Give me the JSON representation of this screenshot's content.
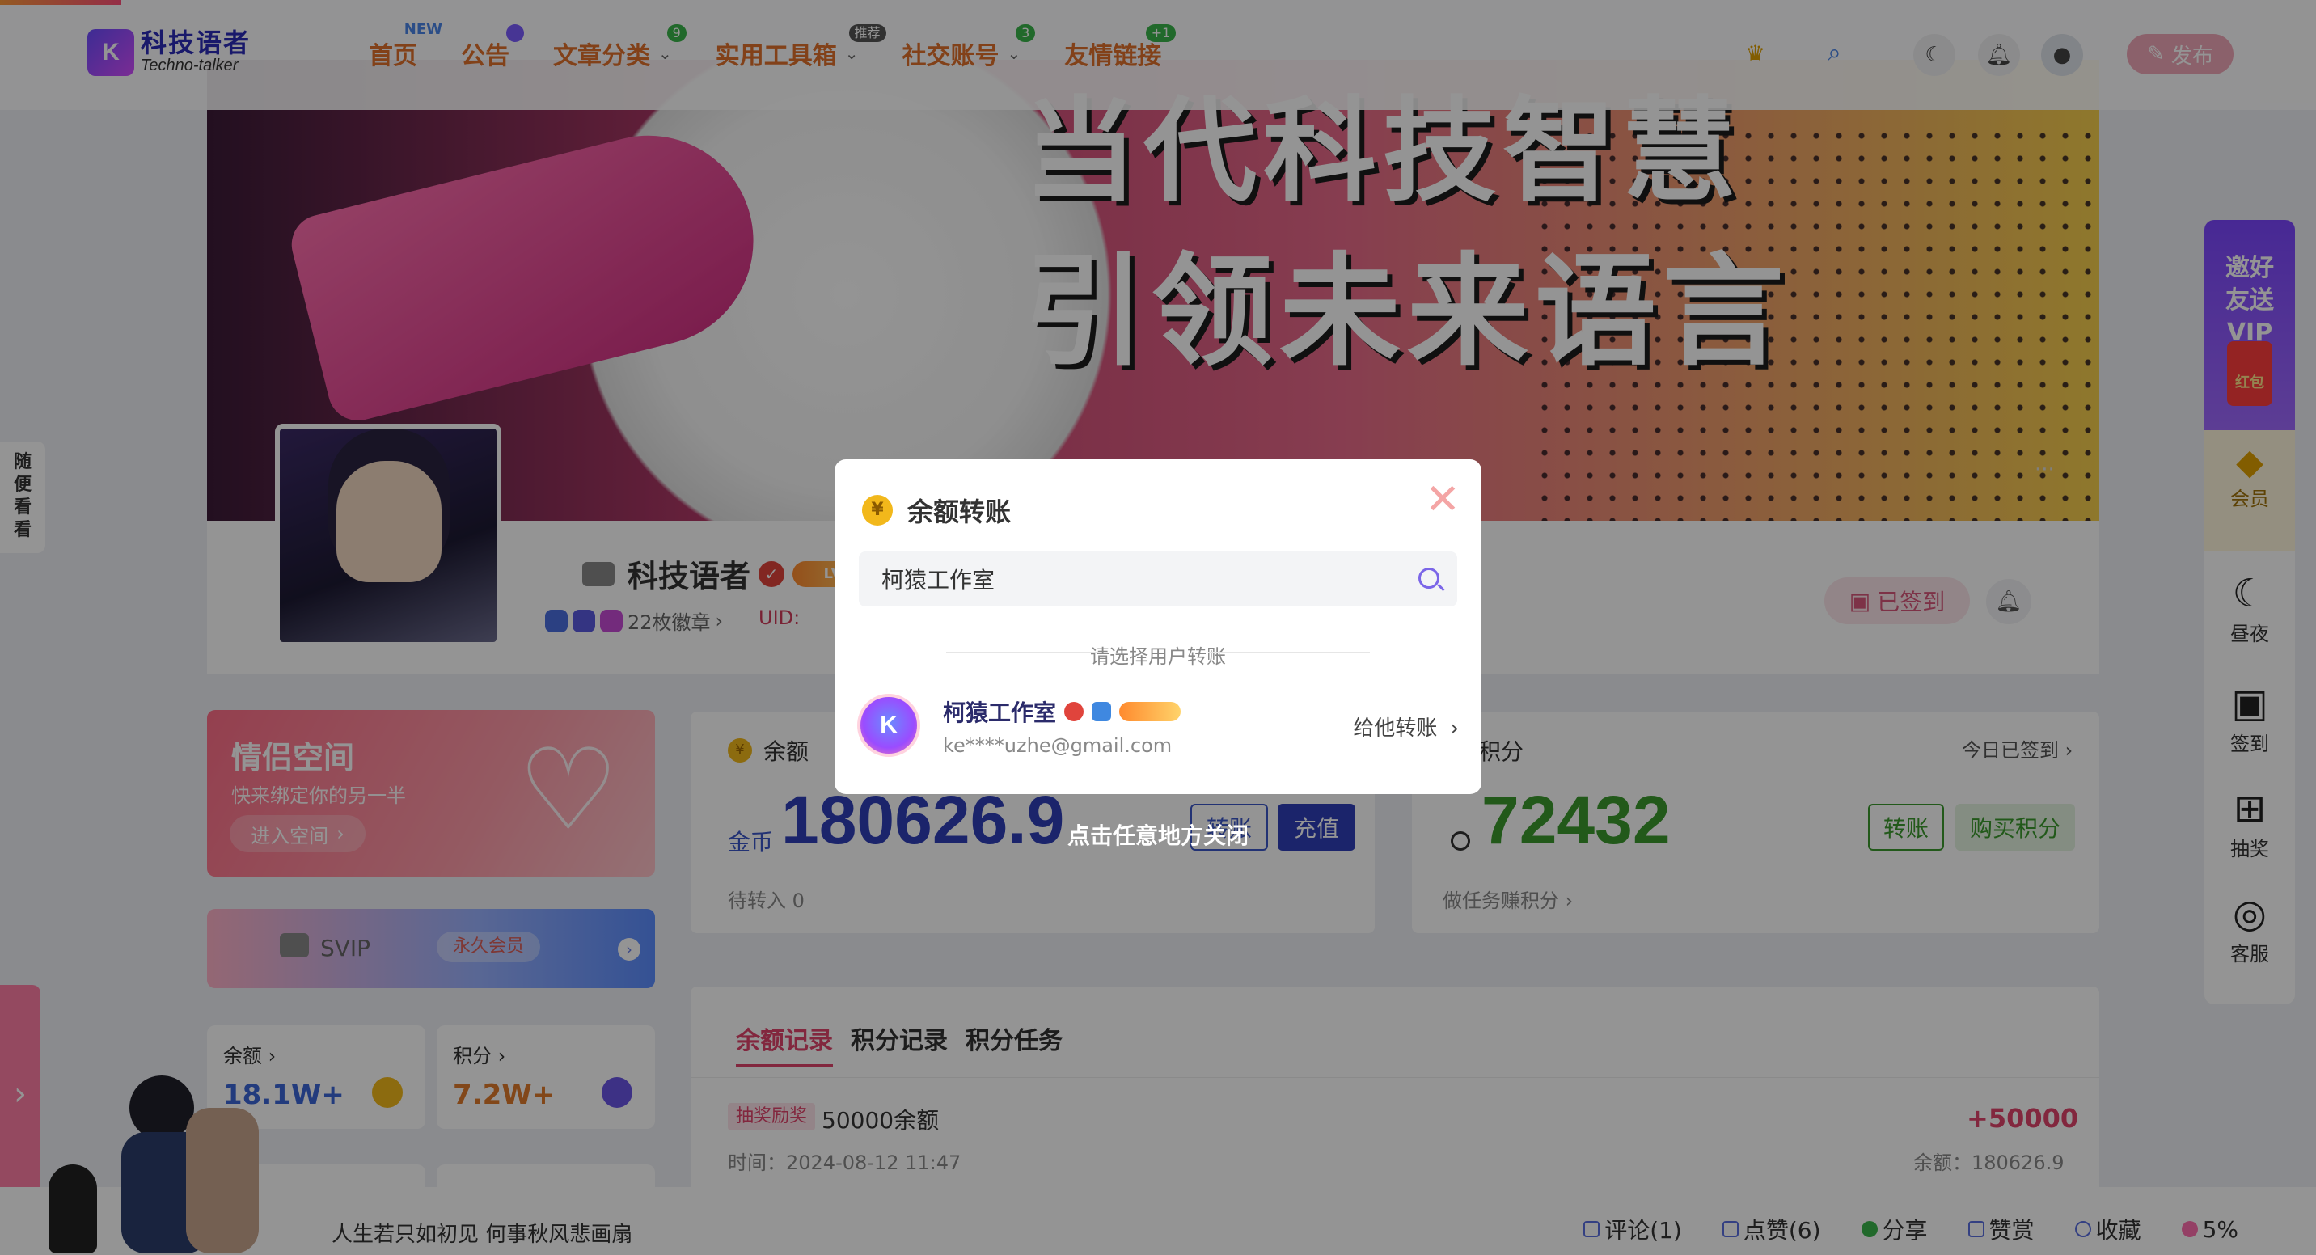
{
  "nav": {
    "logo_cn": "科技语者",
    "logo_en": "Techno-talker",
    "items": [
      {
        "label": "首页",
        "badge": "NEW"
      },
      {
        "label": "公告",
        "badge": ""
      },
      {
        "label": "文章分类",
        "badge": "9"
      },
      {
        "label": "实用工具箱",
        "badge": "推荐"
      },
      {
        "label": "社交账号",
        "badge": "3"
      },
      {
        "label": "友情链接",
        "badge": "+1"
      }
    ],
    "publish": "发布"
  },
  "banner": {
    "line1": "当代科技智慧",
    "line2": "引领未来语言"
  },
  "profile": {
    "name": "科技语者",
    "badges": "22枚徽章",
    "uid": "UID:",
    "signed": "已签到"
  },
  "couple": {
    "title": "情侣空间",
    "subtitle": "快来绑定你的另一半",
    "enter": "进入空间"
  },
  "svip": {
    "label": "SVIP",
    "perm": "永久会员"
  },
  "mini": {
    "balance_label": "余额",
    "balance_value": "18.1W+",
    "points_label": "积分",
    "points_value": "7.2W+"
  },
  "balance_card": {
    "title": "余额",
    "unit": "金币",
    "value": "180626.9",
    "transfer": "转账",
    "recharge": "充值",
    "pending": "待转入 0"
  },
  "points_card": {
    "title": "积分",
    "signed_today": "今日已签到",
    "value": "72432",
    "transfer": "转账",
    "buy": "购买积分",
    "earn": "做任务赚积分"
  },
  "records": {
    "tabs": [
      "余额记录",
      "积分记录",
      "积分任务"
    ],
    "tag": "抽奖励奖",
    "desc": "50000余额",
    "amount": "+50000",
    "time": "时间：2024-08-12 11:47",
    "balance": "余额：180626.9"
  },
  "right_sidebar": {
    "invite": "邀好友送VIP",
    "envelope": "红包",
    "vip": "会员",
    "night": "昼夜",
    "checkin": "签到",
    "lottery": "抽奖",
    "service": "客服"
  },
  "left_float": {
    "random": "随便看看"
  },
  "bottom": {
    "poem": "人生若只如初见 何事秋风悲画扇",
    "comment": "评论(1)",
    "like": "点赞(6)",
    "share": "分享",
    "reward": "赞赏",
    "favorite": "收藏",
    "progress": "5%"
  },
  "modal": {
    "title": "余额转账",
    "search_value": "柯猿工作室",
    "hint": "请选择用户转账",
    "user_name": "柯猿工作室",
    "user_email": "ke****uzhe@gmail.com",
    "give": "给他转账",
    "close_hint": "点击任意地方关闭"
  }
}
